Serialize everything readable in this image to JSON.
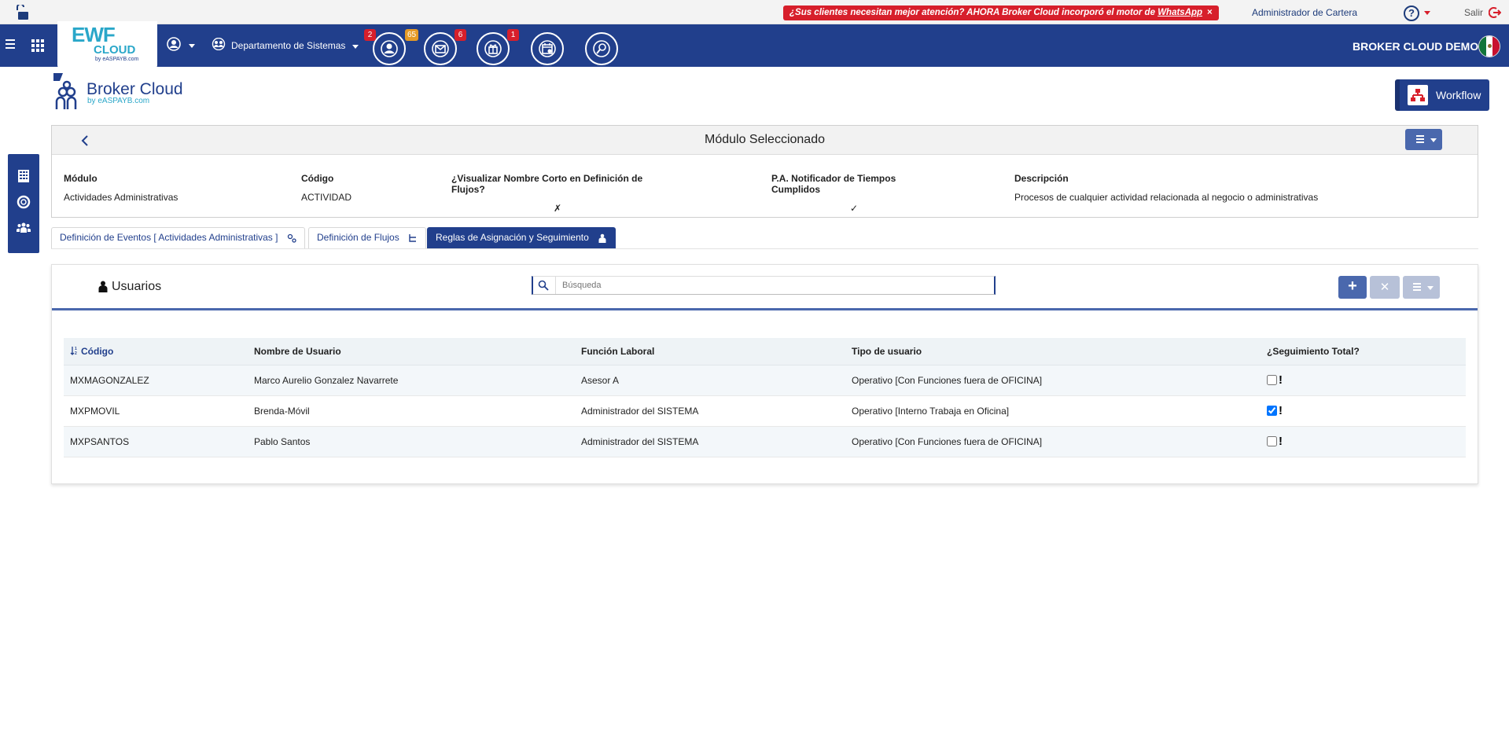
{
  "topbar": {
    "promo_text": "¿Sus clientes necesitan mejor atención? AHORA Broker Cloud incorporó el motor de ",
    "promo_link": "WhatsApp",
    "promo_close": "×",
    "admin_label": "Administrador de Cartera",
    "help": "?",
    "salir": "Salir"
  },
  "navbar": {
    "logo_wf": "EWF",
    "logo_cloud": "CLOUD",
    "logo_by": "by eASPAYB.com",
    "department": "Departamento de Sistemas",
    "badges": {
      "contacts": "2",
      "contacts_extra": "65",
      "mail": "6",
      "gifts": "1"
    },
    "brand": "BROKER CLOUD DEMO"
  },
  "brand_row": {
    "name": "Broker Cloud",
    "by": "by eASPAYB.com",
    "workflow_label": "Workflow"
  },
  "module": {
    "title": "Módulo Seleccionado",
    "columns": [
      {
        "header": "Módulo",
        "value": "Actividades Administrativas"
      },
      {
        "header": "Código",
        "value": "ACTIVIDAD"
      },
      {
        "header": "¿Visualizar Nombre Corto en Definición de Flujos?",
        "value": "✗"
      },
      {
        "header": "P.A. Notificador de Tiempos Cumplidos",
        "value": "✓"
      },
      {
        "header": "Descripción",
        "value": "Procesos de cualquier actividad relacionada al negocio o administrativas"
      }
    ]
  },
  "tabs": [
    {
      "label": "Definición de Eventos [ Actividades Administrativas ]"
    },
    {
      "label": "Definición de Flujos"
    },
    {
      "label": "Reglas de Asignación y Seguimiento"
    }
  ],
  "users": {
    "title": "Usuarios",
    "search_placeholder": "Búsqueda",
    "add_label": "+",
    "delete_label": "✕",
    "columns": [
      "Código",
      "Nombre de Usuario",
      "Función Laboral",
      "Tipo de usuario",
      "¿Seguimiento Total?"
    ],
    "rows": [
      {
        "code": "MXMAGONZALEZ",
        "name": "Marco Aurelio Gonzalez Navarrete",
        "role": "Asesor A",
        "type": "Operativo [Con Funciones fuera de OFICINA]",
        "follow": false
      },
      {
        "code": "MXPMOVIL",
        "name": "Brenda-Móvil",
        "role": "Administrador del SISTEMA",
        "type": "Operativo [Interno Trabaja en Oficina]",
        "follow": true
      },
      {
        "code": "MXPSANTOS",
        "name": "Pablo Santos",
        "role": "Administrador del SISTEMA",
        "type": "Operativo [Con Funciones fuera de OFICINA]",
        "follow": false
      }
    ],
    "exclamation": "!"
  },
  "colors": {
    "primary": "#213f8c",
    "accent": "#4a68ad",
    "alert": "#d71f2b",
    "cyan": "#2aa7c9"
  },
  "icons": [
    "lock-open-icon",
    "help-icon",
    "logout-icon",
    "hamburger-icon",
    "apps-grid-icon",
    "user-icon",
    "department-icon",
    "contacts-icon",
    "mail-icon",
    "gift-icon",
    "calendar-icon",
    "user-search-icon",
    "building-icon",
    "lifebuoy-icon",
    "team-icon",
    "chevron-left-icon",
    "search-icon",
    "sort-icon",
    "workflow-icon"
  ]
}
